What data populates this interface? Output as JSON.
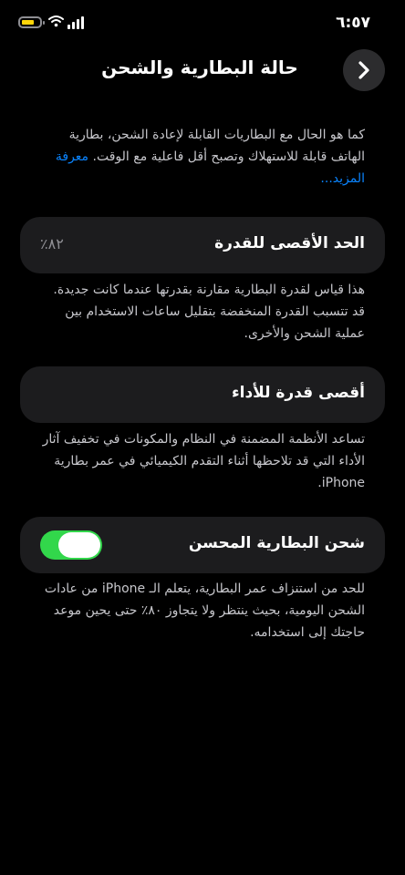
{
  "status_bar": {
    "time": "٦:٥٧",
    "battery_color": "#ffd60a",
    "icons": [
      "battery-icon",
      "wifi-icon",
      "signal-icon"
    ]
  },
  "header": {
    "title": "حالة البطارية والشحن",
    "back_icon": "chevron-right-icon"
  },
  "intro": {
    "text": "كما هو الحال مع البطاريات القابلة لإعادة الشحن، بطارية الهاتف قابلة للاستهلاك وتصبح أقل فاعلية مع الوقت.",
    "link": "معرفة المزيد..."
  },
  "max_capacity": {
    "label": "الحد الأقصى للقدرة",
    "value": "٨٢٪",
    "description": "هذا قياس لقدرة البطارية مقارنة بقدرتها عندما كانت جديدة. قد تتسبب القدرة المنخفضة بتقليل ساعات الاستخدام بين عملية الشحن والأخرى."
  },
  "peak_performance": {
    "label": "أقصى قدرة للأداء",
    "description": "تساعد الأنظمة المضمنة في النظام والمكونات في تخفيف آثار الأداء التي قد تلاحظها أثناء التقدم الكيميائي في عمر بطارية iPhone."
  },
  "optimized_charging": {
    "label": "شحن البطارية المحسن",
    "enabled": true,
    "toggle_color": "#32d74b",
    "description": "للحد من استنزاف عمر البطارية، يتعلم الـ iPhone من عادات الشحن اليومية، بحيث ينتظر ولا يتجاوز ٨٠٪ حتى يحين موعد حاجتك إلى استخدامه."
  }
}
